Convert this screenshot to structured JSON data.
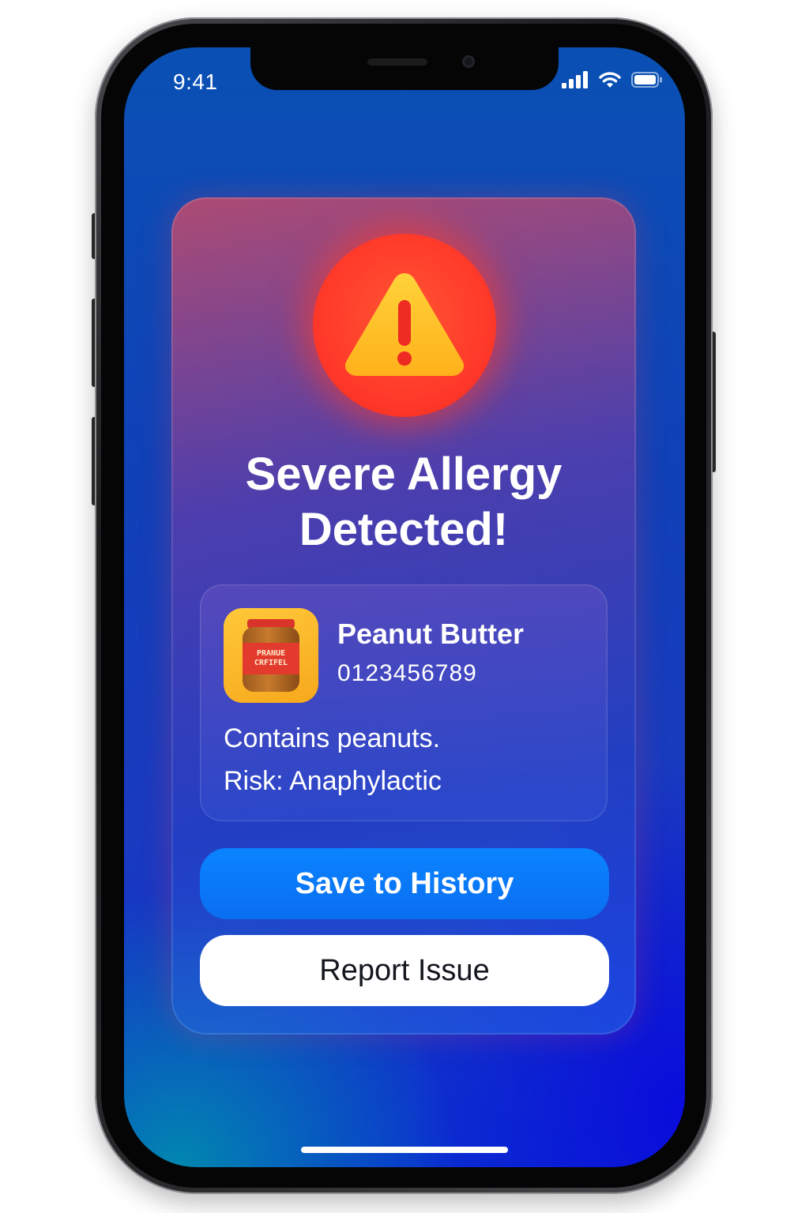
{
  "status_bar": {
    "time": "9:41",
    "icons": [
      "cellular-signal-icon",
      "wifi-icon",
      "battery-icon"
    ]
  },
  "alert": {
    "icon": "warning-triangle-icon",
    "title_line1": "Severe Allergy",
    "title_line2": "Detected!",
    "accent_color": "#ff3a2a"
  },
  "product": {
    "thumbnail_label_line1": "PRANUE",
    "thumbnail_label_line2": "CRFIFEL",
    "name": "Peanut Butter",
    "barcode": "0123456789",
    "note": "Contains peanuts.",
    "risk": "Risk: Anaphylactic"
  },
  "actions": {
    "save_label": "Save to History",
    "report_label": "Report Issue",
    "save_color": "#0a84ff"
  }
}
